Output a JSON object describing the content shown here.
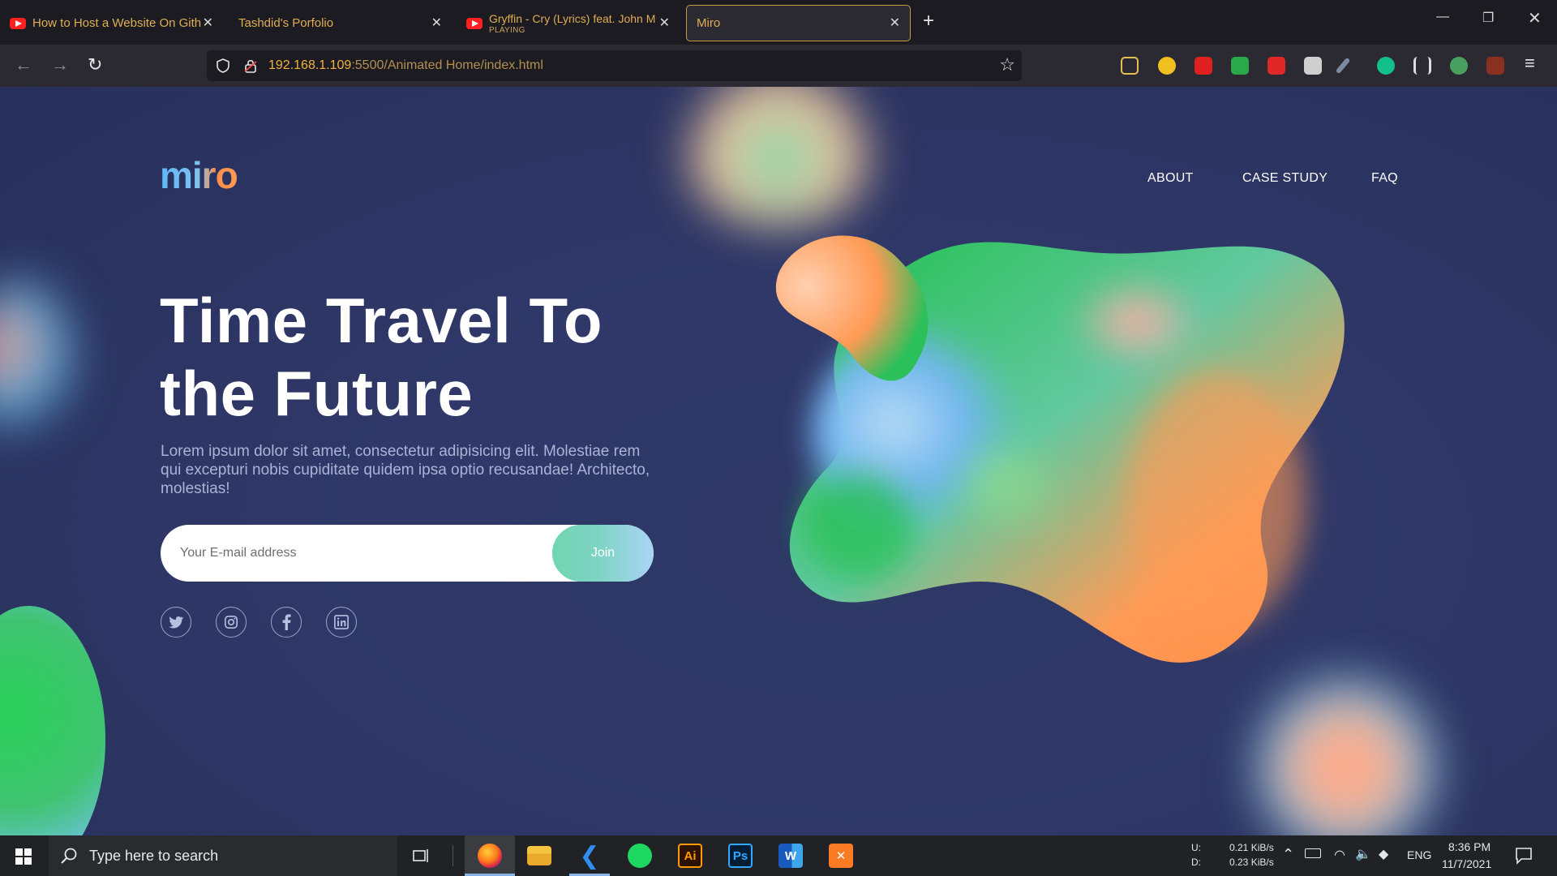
{
  "tabs": [
    {
      "title": "How to Host a Website On Gith",
      "icon": "youtube-icon"
    },
    {
      "title": "Tashdid's Porfolio"
    },
    {
      "title": "Gryffin - Cry (Lyrics) feat. John M",
      "sub": "PLAYING",
      "icon": "youtube-icon"
    },
    {
      "title": "Miro",
      "active": true
    }
  ],
  "address": {
    "host": "192.168.1.109",
    "path": ":5500/Animated Home/index.html"
  },
  "site": {
    "logo": "miro",
    "nav": [
      "ABOUT",
      "CASE STUDY",
      "FAQ"
    ],
    "headline": "Time Travel To the Future",
    "description": "Lorem ipsum dolor sit amet, consectetur adipisicing elit. Molestiae rem qui excepturi nobis cupiditate quidem ipsa optio recusandae! Architecto, molestias!",
    "email_placeholder": "Your E-mail address",
    "join_label": "Join",
    "social": [
      "twitter-icon",
      "instagram-icon",
      "facebook-icon",
      "linkedin-icon"
    ]
  },
  "taskbar": {
    "search_placeholder": "Type here to search",
    "net_up_label": "U:",
    "net_down_label": "D:",
    "net_up": "0.21 KiB/s",
    "net_down": "0.23 KiB/s",
    "lang": "ENG",
    "time": "8:36 PM",
    "date": "11/7/2021",
    "apps": [
      "firefox",
      "file-explorer",
      "vscode",
      "spotify",
      "illustrator",
      "photoshop",
      "word",
      "xampp"
    ]
  },
  "colors": {
    "accent": "#e0ad52",
    "page_bg": "#2f3868",
    "join_start": "#6fd6b0",
    "join_end": "#a9d5f5"
  }
}
